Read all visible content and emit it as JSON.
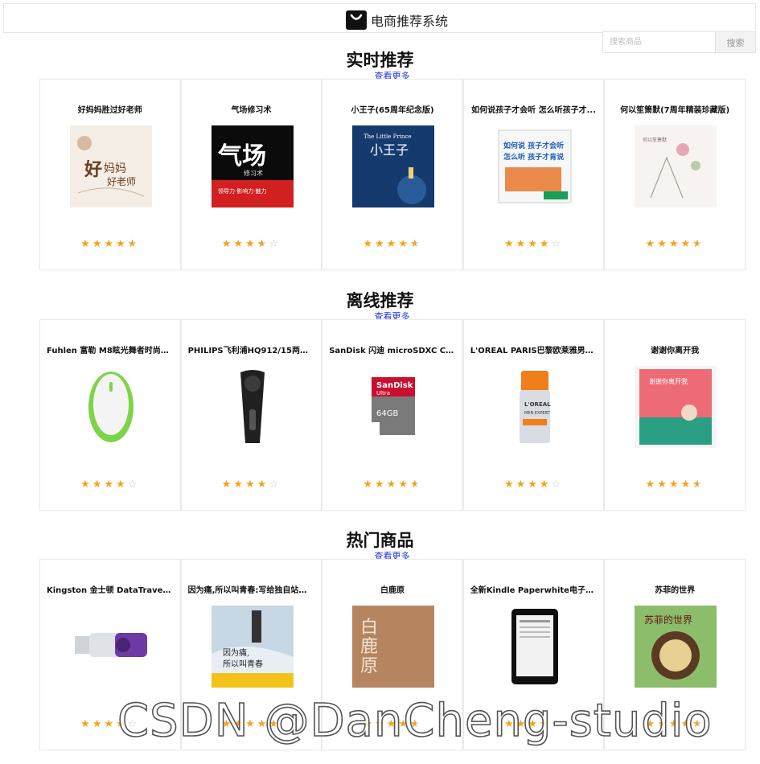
{
  "header": {
    "app_title": "电商推荐系统",
    "logo_icon": "shopping-bag-icon"
  },
  "search": {
    "placeholder": "搜索商品",
    "button_label": "搜索"
  },
  "sections": [
    {
      "title": "实时推荐",
      "more_link": "查看更多",
      "products": [
        {
          "title": "好妈妈胜过好老师",
          "rating": 4.5,
          "cover": "parenting-book-cover"
        },
        {
          "title": "气场修习术",
          "rating": 3.5,
          "cover": "aura-book-cover"
        },
        {
          "title": "小王子(65周年纪念版)",
          "rating": 4.5,
          "cover": "little-prince-cover"
        },
        {
          "title": "如何说孩子才会听 怎么听孩子才...",
          "rating": 4,
          "cover": "how-to-talk-book-cover"
        },
        {
          "title": "何以笙箫默(7周年精装珍藏版)",
          "rating": 4.5,
          "cover": "novel-cover"
        }
      ]
    },
    {
      "title": "离线推荐",
      "more_link": "查看更多",
      "products": [
        {
          "title": "Fuhlen 富勒 M8眩光舞者时尚节...",
          "rating": 4,
          "cover": "mouse-product"
        },
        {
          "title": "PHILIPS飞利浦HQ912/15两刀头...",
          "rating": 4,
          "cover": "shaver-product"
        },
        {
          "title": "SanDisk 闪迪 microSDXC Class...",
          "rating": 4.5,
          "cover": "sd-card-product"
        },
        {
          "title": "L'OREAL PARIS巴黎欧莱雅男士...",
          "rating": 4,
          "cover": "lotion-product"
        },
        {
          "title": "谢谢你离开我",
          "rating": 4.5,
          "cover": "essay-book-cover"
        }
      ]
    },
    {
      "title": "热门商品",
      "more_link": "查看更多",
      "products": [
        {
          "title": "Kingston 金士顿 DataTraveler ...",
          "rating": 4,
          "cover": "usb-drive-product"
        },
        {
          "title": "因为痛,所以叫青春:写给独自站在...",
          "rating": 4.5,
          "cover": "youth-book-cover"
        },
        {
          "title": "白鹿原",
          "rating": 4.5,
          "cover": "bailuyuan-book-cover"
        },
        {
          "title": "全新Kindle Paperwhite电子书...",
          "rating": 4,
          "cover": "kindle-product"
        },
        {
          "title": "苏菲的世界",
          "rating": 4.5,
          "cover": "sophie-world-book-cover"
        }
      ]
    }
  ],
  "watermark": "CSDN @DanCheng-studio",
  "colors": {
    "star": "#f7a21b",
    "star_empty": "#c9c9c9",
    "link": "#2233dd",
    "card_border": "#ececec"
  }
}
